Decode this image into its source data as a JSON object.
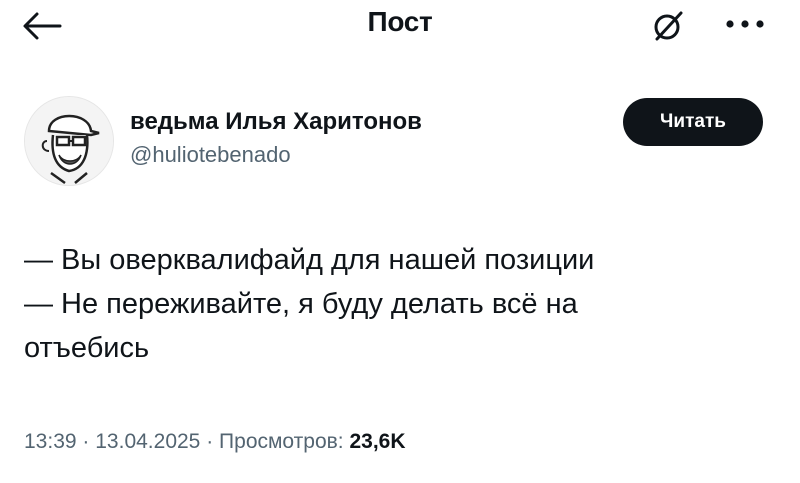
{
  "header": {
    "title": "Пост",
    "back_icon": "arrow-left-icon",
    "grok_icon": "grok-icon",
    "more_icon": "more-dots-icon"
  },
  "author": {
    "display_name": "ведьма Илья Харитонов",
    "handle": "@huliotebenado",
    "follow_label": "Читать"
  },
  "tweet": {
    "lines": [
      "— Вы оверквалифайд для нашей позиции",
      "— Не переживайте, я буду делать всё на",
      "отъебись"
    ]
  },
  "meta": {
    "time": "13:39",
    "separator": "·",
    "date": "13.04.2025",
    "views_label": "Просмотров:",
    "views_count": "23,6K"
  },
  "colors": {
    "text": "#0f1419",
    "secondary": "#536471",
    "button_bg": "#0f1419",
    "button_text": "#ffffff"
  }
}
